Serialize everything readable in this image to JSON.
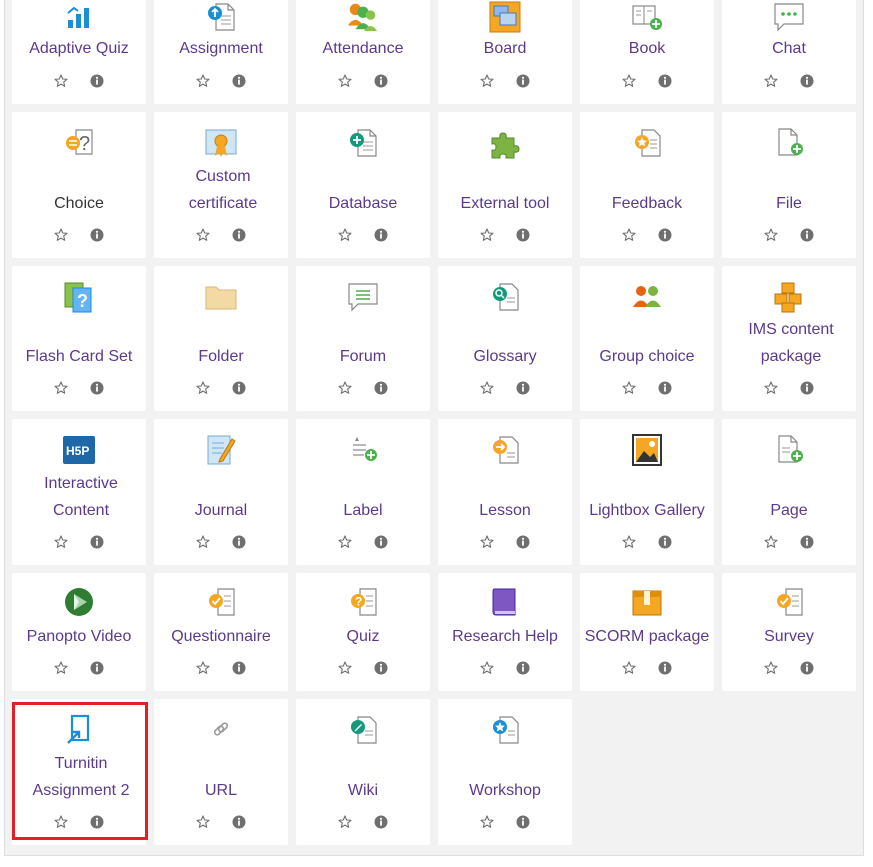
{
  "activities": [
    {
      "label": "Adaptive Quiz",
      "icon": "bar-chart-icon"
    },
    {
      "label": "Assignment",
      "icon": "assignment-upload-icon"
    },
    {
      "label": "Attendance",
      "icon": "people-group-icon"
    },
    {
      "label": "Board",
      "icon": "board-icon"
    },
    {
      "label": "Book",
      "icon": "book-add-icon"
    },
    {
      "label": "Chat",
      "icon": "chat-bubble-icon"
    },
    {
      "label": "Choice",
      "icon": "choice-question-icon"
    },
    {
      "label": "Custom certificate",
      "icon": "certificate-icon"
    },
    {
      "label": "Database",
      "icon": "database-icon"
    },
    {
      "label": "External tool",
      "icon": "puzzle-icon"
    },
    {
      "label": "Feedback",
      "icon": "feedback-star-icon"
    },
    {
      "label": "File",
      "icon": "file-add-icon"
    },
    {
      "label": "Flash Card Set",
      "icon": "flash-card-icon"
    },
    {
      "label": "Folder",
      "icon": "folder-icon"
    },
    {
      "label": "Forum",
      "icon": "forum-icon"
    },
    {
      "label": "Glossary",
      "icon": "glossary-search-icon"
    },
    {
      "label": "Group choice",
      "icon": "group-choice-icon"
    },
    {
      "label": "IMS content package",
      "icon": "boxes-icon"
    },
    {
      "label": "Interactive Content",
      "icon": "h5p-icon"
    },
    {
      "label": "Journal",
      "icon": "journal-pencil-icon"
    },
    {
      "label": "Label",
      "icon": "label-add-icon"
    },
    {
      "label": "Lesson",
      "icon": "lesson-arrow-icon"
    },
    {
      "label": "Lightbox Gallery",
      "icon": "gallery-image-icon"
    },
    {
      "label": "Page",
      "icon": "page-add-icon"
    },
    {
      "label": "Panopto Video",
      "icon": "panopto-icon"
    },
    {
      "label": "Questionnaire",
      "icon": "questionnaire-check-icon"
    },
    {
      "label": "Quiz",
      "icon": "quiz-question-icon"
    },
    {
      "label": "Research Help",
      "icon": "purple-book-icon"
    },
    {
      "label": "SCORM package",
      "icon": "scorm-box-icon"
    },
    {
      "label": "Survey",
      "icon": "survey-check-icon"
    },
    {
      "label": "Turnitin Assignment 2",
      "icon": "turnitin-icon"
    },
    {
      "label": "URL",
      "icon": "link-icon"
    },
    {
      "label": "Wiki",
      "icon": "wiki-edit-icon"
    },
    {
      "label": "Workshop",
      "icon": "workshop-star-icon"
    }
  ],
  "colors": {
    "label_purple": "#5b3a8c",
    "label_dark": "#333333",
    "highlight_red": "#e3202a",
    "icon_grey": "#6f6f6f"
  }
}
